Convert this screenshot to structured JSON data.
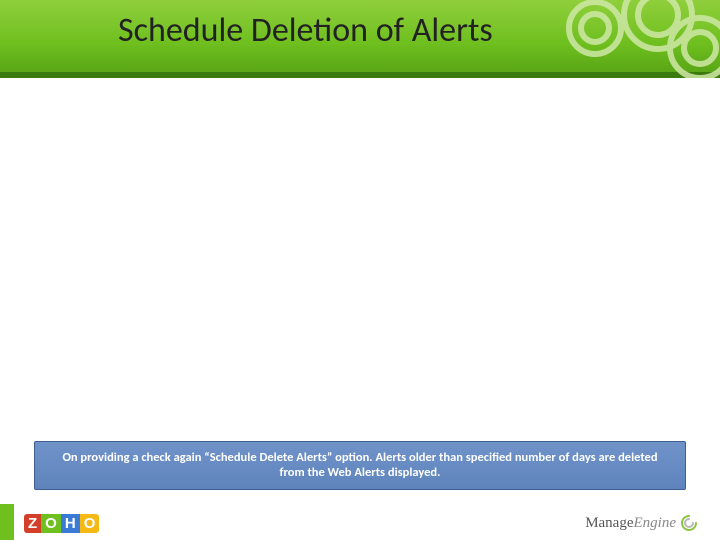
{
  "title": "Schedule Deletion of Alerts",
  "callout_text": "On providing a check again “Schedule Delete Alerts” option. Alerts older than specified number of days are deleted from the Web Alerts displayed.",
  "footer": {
    "zoho": {
      "z": "Z",
      "o1": "O",
      "h": "H",
      "o2": "O"
    },
    "manageengine": {
      "manage": "Manage",
      "engine": "Engine"
    }
  }
}
